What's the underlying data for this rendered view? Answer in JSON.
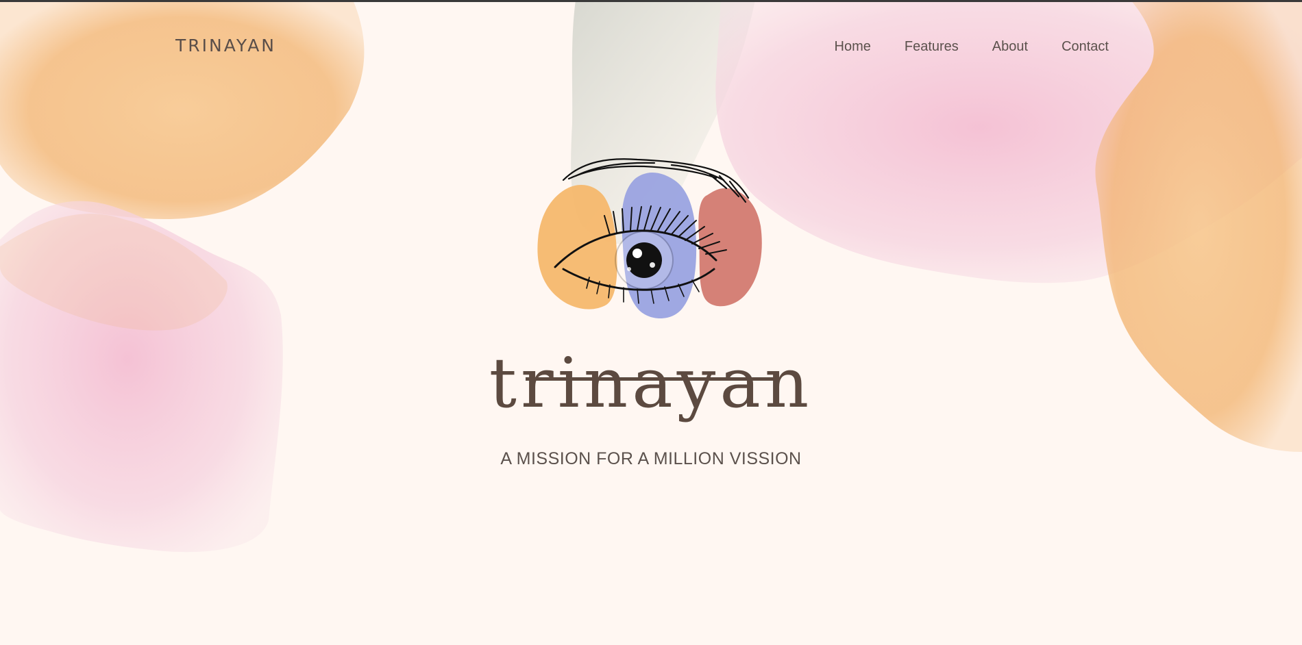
{
  "nav": {
    "brand": "TRINAYAN",
    "items": [
      {
        "label": "Home"
      },
      {
        "label": "Features"
      },
      {
        "label": "About"
      },
      {
        "label": "Contact"
      }
    ]
  },
  "hero": {
    "logo_icon": "eye-logo-icon",
    "title": "trinayan",
    "tagline": "A MISSION FOR A MILLION VISSION"
  },
  "colors": {
    "background": "#fff7f2",
    "text": "#5b514c",
    "title": "#5c4a40",
    "orange_blob": "#f6b86d",
    "pink_blob": "#f2bfd5",
    "blue_blob": "#9aa3e0",
    "red_blob": "#d37a70"
  }
}
